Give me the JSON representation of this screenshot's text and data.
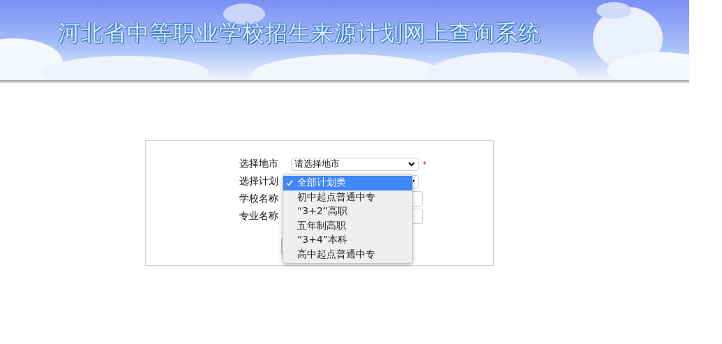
{
  "header": {
    "title": "河北省中等职业学校招生来源计划网上查询系统"
  },
  "form": {
    "fields": [
      {
        "label": "选择地市",
        "kind": "select",
        "value": "请选择地市",
        "required_mark": "*"
      },
      {
        "label": "选择计划",
        "kind": "select"
      },
      {
        "label": "学校名称",
        "kind": "input"
      },
      {
        "label": "专业名称",
        "kind": "input"
      }
    ]
  },
  "dropdown": {
    "options": [
      {
        "label": "全部计划类",
        "selected": true
      },
      {
        "label": "初中起点普通中专",
        "selected": false
      },
      {
        "label": "“3+2”高职",
        "selected": false
      },
      {
        "label": "五年制高职",
        "selected": false
      },
      {
        "label": "“3+4”本科",
        "selected": false
      },
      {
        "label": "高中起点普通中专",
        "selected": false
      }
    ]
  }
}
